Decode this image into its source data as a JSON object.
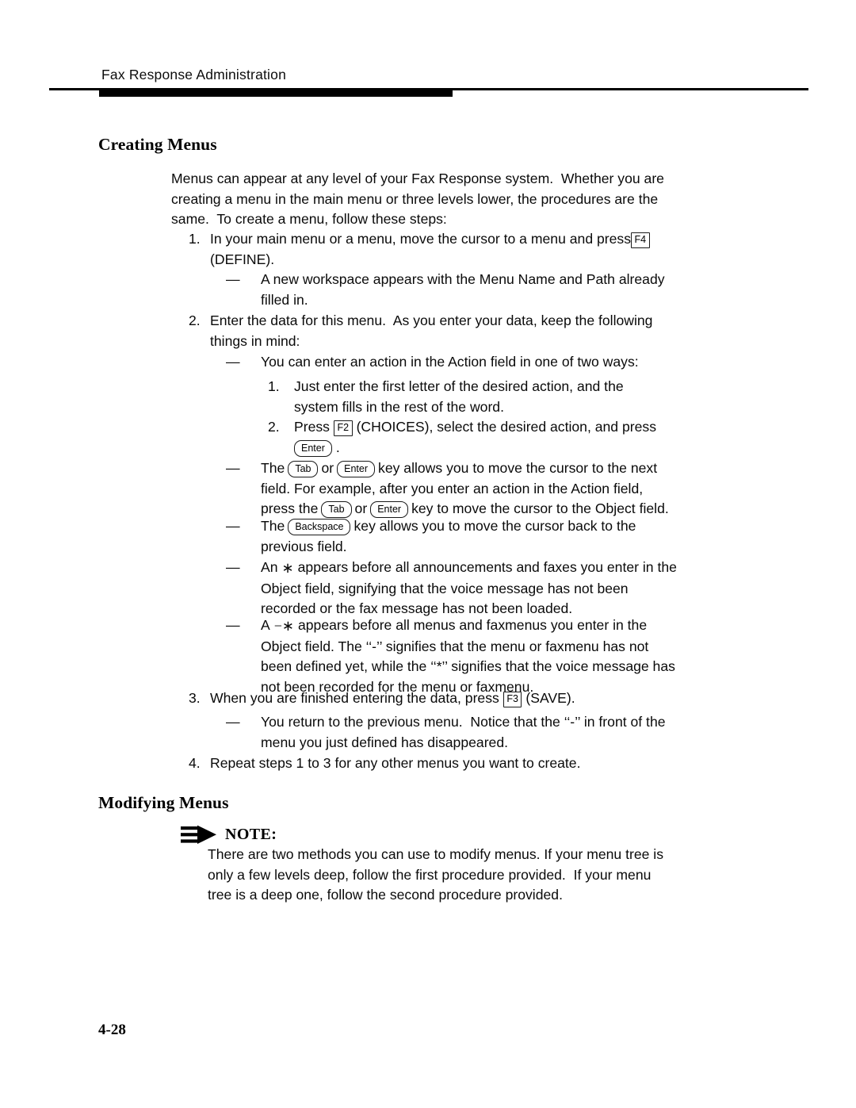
{
  "header": {
    "running_title": "Fax Response Administration"
  },
  "sections": {
    "creating": {
      "heading": "Creating Menus",
      "intro": [
        "Menus can appear at any level of your Fax Response system.  Whether you are",
        "creating a menu in the main menu or three levels lower, the procedures are the",
        "same.  To create a menu, follow these steps:"
      ],
      "step1": {
        "marker": "1.",
        "line1_before": "In your main menu or a menu, move the cursor to a menu and press",
        "key": "F4",
        "line2": "(DEFINE)."
      },
      "step1_dash": {
        "marker": "—",
        "lines": [
          "A new workspace appears with the Menu Name and Path already",
          "filled in."
        ]
      },
      "step2": {
        "marker": "2.",
        "lines": [
          "Enter the data for this menu.  As you enter your data, keep the following",
          "things in mind:"
        ]
      },
      "step2_dash1": {
        "marker": "—",
        "lines": [
          "You can enter an action in the Action field in one of two ways:"
        ]
      },
      "sub1": {
        "marker": "1.",
        "lines": [
          "Just enter the first letter of the desired action, and the",
          "system fills in the rest of the word."
        ]
      },
      "sub2": {
        "marker": "2.",
        "before_key": "Press",
        "key1": "F2",
        "after_key": "(CHOICES), select the desired action, and press",
        "key2": "Enter",
        "trailing": "."
      },
      "step2_dash2": {
        "marker": "—",
        "l1_a": "The",
        "l1_key1": "Tab",
        "l1_b": "or",
        "l1_key2": "Enter",
        "l1_c": "key allows you to move the cursor to the next",
        "l2": "field. For example, after you enter an action in the Action field,",
        "l3_a": "press the",
        "l3_key1": "Tab",
        "l3_b": "or",
        "l3_key2": "Enter",
        "l3_c": "key to move the cursor to the Object field."
      },
      "step2_dash3": {
        "marker": "—",
        "l1_a": "The",
        "l1_key": "Backspace",
        "l1_b": "key allows you to move the cursor back to the",
        "l2": "previous field."
      },
      "step2_dash4": {
        "marker": "—",
        "l1_a": "An",
        "l1_symbol": "∗",
        "l1_b": "appears before all announcements and faxes you enter in the",
        "l2": "Object field, signifying that the voice message has not been",
        "l3": "recorded or the fax message has not been loaded."
      },
      "step2_dash5": {
        "marker": "—",
        "l1_a": "A",
        "l1_symbol": "−∗",
        "l1_b": "appears before all menus and faxmenus you enter in the",
        "l2": "Object field. The ‘‘-’’ signifies that the menu or faxmenu has not",
        "l3": "been defined yet, while the ‘‘*’’ signifies that the voice message has",
        "l4": "not been recorded for the menu or faxmenu."
      },
      "step3": {
        "marker": "3.",
        "before_key": "When you are finished entering the data, press",
        "key": "F3",
        "after_key": "(SAVE)."
      },
      "step3_dash": {
        "marker": "—",
        "lines": [
          "You return to the previous menu.  Notice that the ‘‘-’’ in front of the",
          "menu you just defined has disappeared."
        ]
      },
      "step4": {
        "marker": "4.",
        "lines": [
          "Repeat steps 1 to 3 for any other menus you want to create."
        ]
      }
    },
    "modifying": {
      "heading": "Modifying Menus",
      "note": {
        "icon": "note-arrow-icon",
        "label": "NOTE:",
        "lines": [
          "There are two methods you can use to modify menus. If your menu tree is",
          "only a few levels deep, follow the first procedure provided.  If your menu",
          "tree is a deep one, follow the second procedure provided."
        ]
      }
    }
  },
  "footer": {
    "page_number": "4-28"
  },
  "colors": {
    "text": "#000000",
    "rule": "#000000",
    "page_bg": "#ffffff"
  }
}
